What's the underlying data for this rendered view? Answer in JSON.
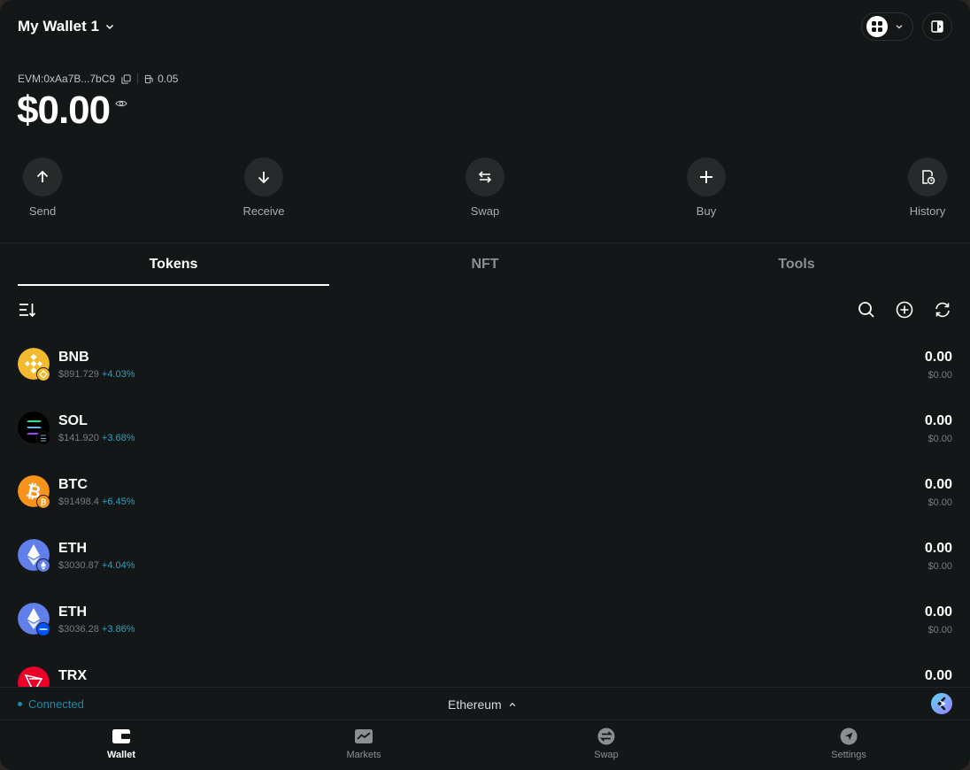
{
  "header": {
    "wallet_name": "My Wallet 1",
    "address": "EVM:0xAa7B...7bC9",
    "gas": "0.05",
    "balance": "$0.00"
  },
  "actions": [
    {
      "label": "Send",
      "icon": "arrow-up-icon"
    },
    {
      "label": "Receive",
      "icon": "arrow-down-icon"
    },
    {
      "label": "Swap",
      "icon": "swap-icon"
    },
    {
      "label": "Buy",
      "icon": "plus-icon"
    },
    {
      "label": "History",
      "icon": "history-icon"
    }
  ],
  "tabs": [
    {
      "label": "Tokens",
      "active": true
    },
    {
      "label": "NFT",
      "active": false
    },
    {
      "label": "Tools",
      "active": false
    }
  ],
  "tokens": [
    {
      "symbol": "BNB",
      "price": "$891.729",
      "change": "+4.03%",
      "amount": "0.00",
      "value": "$0.00",
      "color": "#f3ba2f"
    },
    {
      "symbol": "SOL",
      "price": "$141.920",
      "change": "+3.68%",
      "amount": "0.00",
      "value": "$0.00",
      "color": "#000000"
    },
    {
      "symbol": "BTC",
      "price": "$91498.4",
      "change": "+6.45%",
      "amount": "0.00",
      "value": "$0.00",
      "color": "#f7931a"
    },
    {
      "symbol": "ETH",
      "price": "$3030.87",
      "change": "+4.04%",
      "amount": "0.00",
      "value": "$0.00",
      "color": "#627eea"
    },
    {
      "symbol": "ETH",
      "price": "$3036.28",
      "change": "+3.86%",
      "amount": "0.00",
      "value": "$0.00",
      "color": "#627eea"
    },
    {
      "symbol": "TRX",
      "price": "",
      "change": "",
      "amount": "0.00",
      "value": "",
      "color": "#eb0029"
    }
  ],
  "status": {
    "connection": "Connected",
    "network": "Ethereum"
  },
  "nav": [
    {
      "label": "Wallet",
      "icon": "wallet-icon",
      "active": true
    },
    {
      "label": "Markets",
      "icon": "markets-icon",
      "active": false
    },
    {
      "label": "Swap",
      "icon": "swap-circle-icon",
      "active": false
    },
    {
      "label": "Settings",
      "icon": "settings-icon",
      "active": false
    }
  ]
}
